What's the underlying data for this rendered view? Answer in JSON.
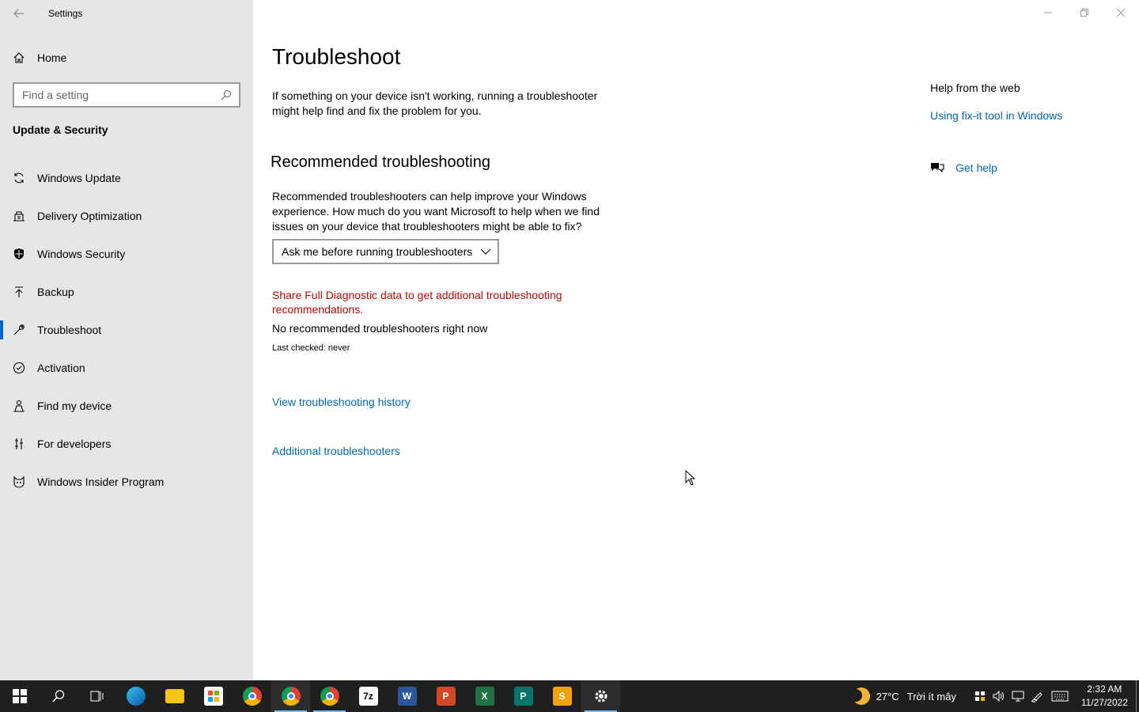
{
  "window": {
    "title": "Settings",
    "controls": [
      "minimize",
      "restore",
      "close"
    ]
  },
  "sidebar": {
    "home_label": "Home",
    "search_placeholder": "Find a setting",
    "section_title": "Update & Security",
    "items": [
      {
        "label": "Windows Update",
        "icon": "sync-icon",
        "active": false
      },
      {
        "label": "Delivery Optimization",
        "icon": "delivery-optimization-icon",
        "active": false
      },
      {
        "label": "Windows Security",
        "icon": "shield-icon",
        "active": false
      },
      {
        "label": "Backup",
        "icon": "backup-arrow-icon",
        "active": false
      },
      {
        "label": "Troubleshoot",
        "icon": "wrench-icon",
        "active": true
      },
      {
        "label": "Activation",
        "icon": "check-circle-icon",
        "active": false
      },
      {
        "label": "Find my device",
        "icon": "person-location-icon",
        "active": false
      },
      {
        "label": "For developers",
        "icon": "developer-tools-icon",
        "active": false
      },
      {
        "label": "Windows Insider Program",
        "icon": "insider-cat-icon",
        "active": false
      }
    ]
  },
  "main": {
    "title": "Troubleshoot",
    "intro": "If something on your device isn't working, running a troubleshooter might help find and fix the problem for you.",
    "recommended_heading": "Recommended troubleshooting",
    "recommended_desc": "Recommended troubleshooters can help improve your Windows experience. How much do you want Microsoft to help when we find issues on your device that troubleshooters might be able to fix?",
    "dropdown_value": "Ask me before running troubleshooters",
    "diagnostic_link": "Share Full Diagnostic data to get additional troubleshooting recommendations.",
    "no_recommended": "No recommended troubleshooters right now",
    "last_checked": "Last checked: never",
    "history_link": "View troubleshooting history",
    "additional_link": "Additional troubleshooters"
  },
  "help": {
    "heading": "Help from the web",
    "web_link": "Using fix-it tool in Windows",
    "get_help": "Get help"
  },
  "taskbar": {
    "apps": [
      {
        "name": "start",
        "icon": "windows-start-icon"
      },
      {
        "name": "search",
        "icon": "search-icon"
      },
      {
        "name": "task-view",
        "icon": "task-view-icon"
      },
      {
        "name": "edge",
        "icon": "edge-icon"
      },
      {
        "name": "file-explorer",
        "icon": "folder-icon"
      },
      {
        "name": "store",
        "icon": "store-icon"
      },
      {
        "name": "chrome",
        "icon": "chrome-icon"
      },
      {
        "name": "chrome-profile-1",
        "icon": "chrome-profile-icon"
      },
      {
        "name": "chrome-profile-2",
        "icon": "chrome-profile-icon"
      },
      {
        "name": "7zip",
        "icon": "7zip-icon",
        "label": "7z"
      },
      {
        "name": "word",
        "icon": "word-icon",
        "label": "W"
      },
      {
        "name": "powerpoint",
        "icon": "powerpoint-icon",
        "label": "P"
      },
      {
        "name": "excel",
        "icon": "excel-icon",
        "label": "X"
      },
      {
        "name": "publisher",
        "icon": "publisher-icon",
        "label": "P"
      },
      {
        "name": "slides",
        "icon": "slides-icon",
        "label": "S"
      },
      {
        "name": "settings",
        "icon": "gear-icon"
      }
    ],
    "weather_temp": "27°C",
    "weather_desc": "Trời ít mây",
    "time": "2:32 AM",
    "date": "11/27/2022"
  },
  "colors": {
    "accent": "#0067c0",
    "link": "#0067b8",
    "warning_link": "#c50500",
    "sidebar_bg": "#e6e6e6",
    "taskbar_bg": "#1f1f1f"
  }
}
